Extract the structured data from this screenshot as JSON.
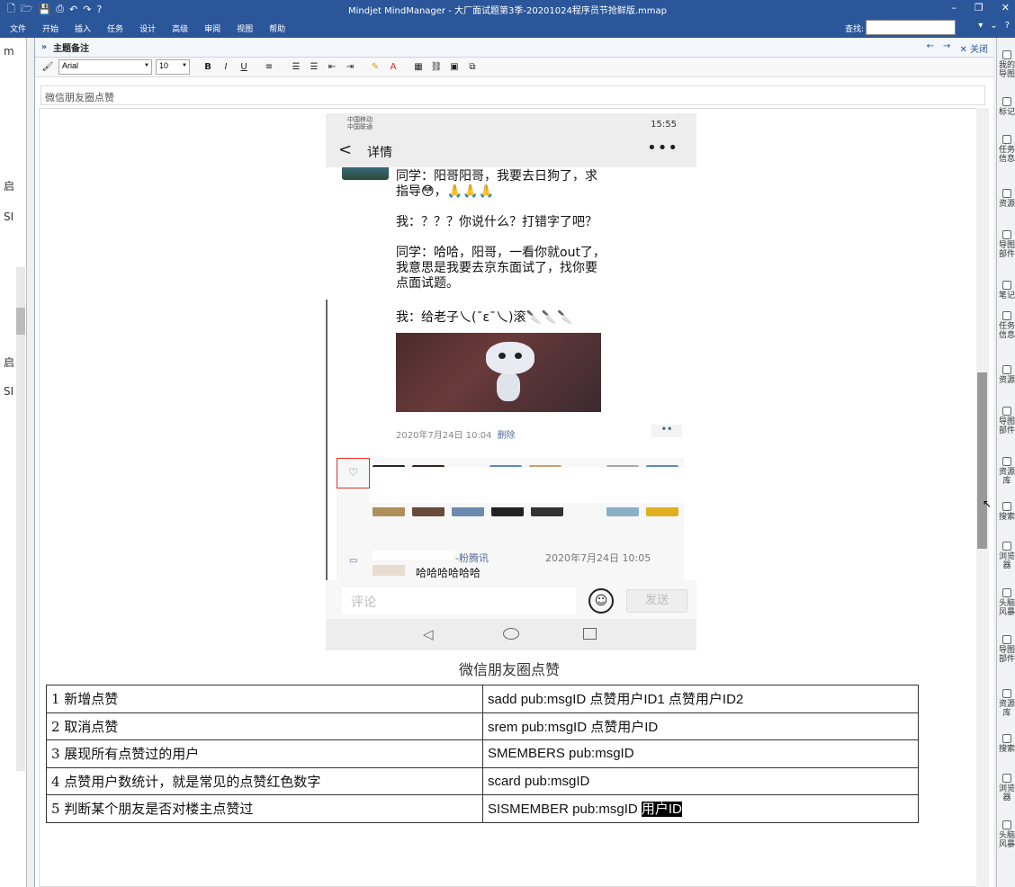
{
  "window": {
    "title": "Mindjet MindManager - 大厂面试题第3季-20201024程序员节抢鲜版.mmap",
    "qat_icons": [
      "new-icon",
      "open-icon",
      "save-icon",
      "print-icon",
      "undo-icon",
      "redo-icon",
      "help-icon"
    ]
  },
  "menu": {
    "items": [
      "文件",
      "开始",
      "插入",
      "任务",
      "设计",
      "高级",
      "审阅",
      "视图",
      "帮助"
    ],
    "search_label": "查找:",
    "search_value": ""
  },
  "left_pane": {
    "fragments": [
      "m",
      "启",
      "SI",
      "启",
      "SI"
    ]
  },
  "notes_panel": {
    "title": "主题备注",
    "close_label": "关闭",
    "font_name": "Arial",
    "font_size": "10",
    "topic_title": "微信朋友圈点赞"
  },
  "phone": {
    "carrier1": "中国移动",
    "carrier2": "中国联通",
    "time": "15:55",
    "header_title": "详情",
    "post_lines": [
      "同学：阳哥阳哥，我要去日狗了，求",
      "指导😳，🙏🙏🙏",
      "我：？？？你说什么？打错字了吧？",
      "同学：哈哈，阳哥，一看你就out了，",
      "我意思是我要去京东面试了，找你要",
      "点面试题。",
      "我：给老子乀(ˉεˉ乀)滚🔪🔪🔪"
    ],
    "post_time": "2020年7月24日 10:04",
    "delete_label": "删除",
    "comment_btn": "••",
    "comment_name": "-粉腾讯",
    "comment_time": "2020年7月24日 10:05",
    "comment_text": "哈哈哈哈哈哈",
    "input_placeholder": "评论",
    "send_label": "发送"
  },
  "caption": "微信朋友圈点赞",
  "table": {
    "rows": [
      {
        "desc": "1 新增点赞",
        "cmd": "sadd pub:msgID  点赞用户ID1  点赞用户ID2"
      },
      {
        "desc": "2 取消点赞",
        "cmd": "srem pub:msgID  点赞用户ID"
      },
      {
        "desc": "3 展现所有点赞过的用户",
        "cmd": "SMEMBERS  pub:msgID"
      },
      {
        "desc": "4 点赞用户数统计，就是常见的点赞红色数字",
        "cmd": "scard  pub:msgID"
      },
      {
        "desc": "5 判断某个朋友是否对楼主点赞过",
        "cmd": "SISMEMBER pub:msgID ",
        "cmd_highlight": "用户ID"
      }
    ]
  },
  "right_rail": {
    "items": [
      "我的导图",
      "标记",
      "任务信息",
      "资源",
      "导图部件",
      "笔记",
      "任务信息",
      "资源",
      "导图部件",
      "资源库",
      "搜索",
      "浏览器",
      "头脑风暴",
      "导图部件",
      "资源库",
      "搜索",
      "浏览器",
      "头脑风暴"
    ]
  }
}
